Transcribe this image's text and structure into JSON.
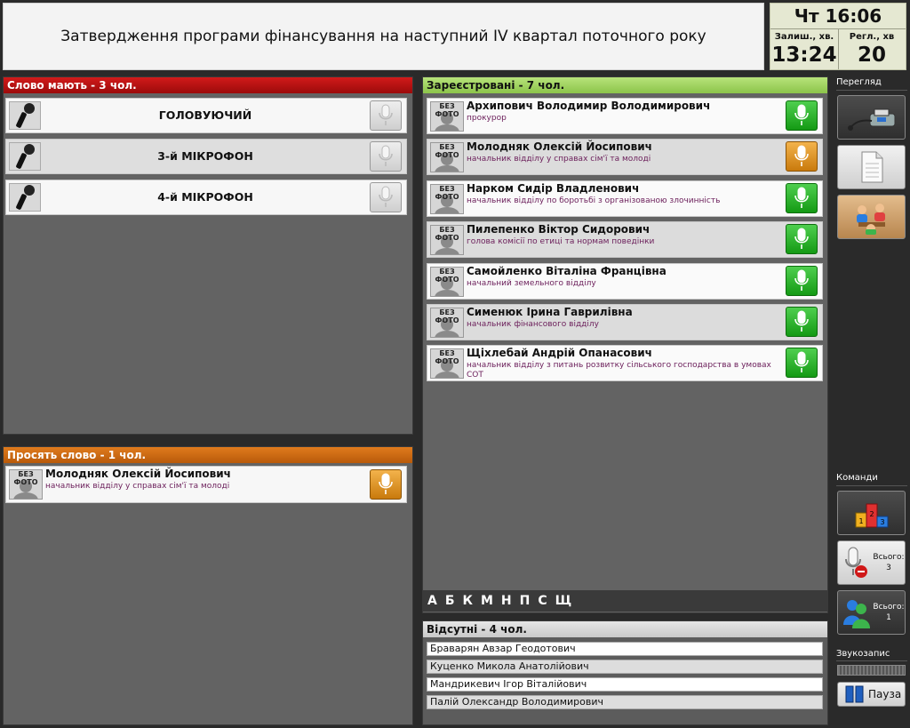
{
  "topic": "Затвердження програми фінансування на наступний IV квартал поточного року",
  "clock": {
    "time": "Чт 16:06",
    "remaining_label": "Залиш., хв.",
    "remaining_value": "13:24",
    "reglament_label": "Регл., хв",
    "reglament_value": "20"
  },
  "speakers": {
    "title": "Слово мають - 3 чол.",
    "items": [
      {
        "label": "ГОЛОВУЮЧИЙ"
      },
      {
        "label": "3-й МІКРОФОН"
      },
      {
        "label": "4-й МІКРОФОН"
      }
    ]
  },
  "requests": {
    "title": "Просять слово - 1 чол.",
    "items": [
      {
        "photo": "БЕЗ ФОТО",
        "name": "Молодняк Олексій Йосипович",
        "position": "начальник відділу у справах сім'ї та молоді"
      }
    ]
  },
  "registered": {
    "title": "Зареєстровані - 7 чол.",
    "items": [
      {
        "photo": "БЕЗ ФОТО",
        "name": "Архипович Володимир Володимирович",
        "position": "прокурор",
        "mic": "green"
      },
      {
        "photo": "БЕЗ ФОТО",
        "name": "Молодняк Олексій Йосипович",
        "position": "начальник відділу у справах сім'ї та молоді",
        "mic": "orange"
      },
      {
        "photo": "БЕЗ ФОТО",
        "name": "Нарком Сидір Владленович",
        "position": "начальник відділу по боротьбі з організованою злочинність",
        "mic": "green"
      },
      {
        "photo": "БЕЗ ФОТО",
        "name": "Пилепенко Віктор Сидорович",
        "position": "голова комісії по етиці та нормам поведінки",
        "mic": "green"
      },
      {
        "photo": "БЕЗ ФОТО",
        "name": "Самойленко Віталіна Францівна",
        "position": "начальний земельного відділу",
        "mic": "green"
      },
      {
        "photo": "БЕЗ ФОТО",
        "name": "Сименюк Ірина Гаврилівна",
        "position": "начальник фінансового відділу",
        "mic": "green"
      },
      {
        "photo": "БЕЗ ФОТО",
        "name": "Щіхлебай Андрій Опанасович",
        "position": "начальник відділу з питань розвитку сільського господарства в умовах СОТ",
        "mic": "green"
      }
    ]
  },
  "letters": [
    "А",
    "Б",
    "К",
    "М",
    "Н",
    "П",
    "С",
    "Щ"
  ],
  "absent": {
    "title": "Відсутні - 4 чол.",
    "items": [
      "Браварян Авзар Геодотович",
      "Куценко Микола Анатолійович",
      "Мандрикевич Ігор Віталійович",
      "Палій Олександр Володимирович"
    ]
  },
  "right": {
    "view_label": "Перегляд",
    "commands_label": "Команди",
    "total_label": "Всього:",
    "total_a": "3",
    "total_b": "1",
    "sound_label": "Звукозапис",
    "pause_label": "Пауза"
  },
  "colors": {
    "speakers_header": "#b50f0f",
    "requests_header": "#c9680f",
    "registered_header": "#a6d65f",
    "mic_green": "#1fa51f",
    "mic_orange": "#dd9a2a"
  }
}
